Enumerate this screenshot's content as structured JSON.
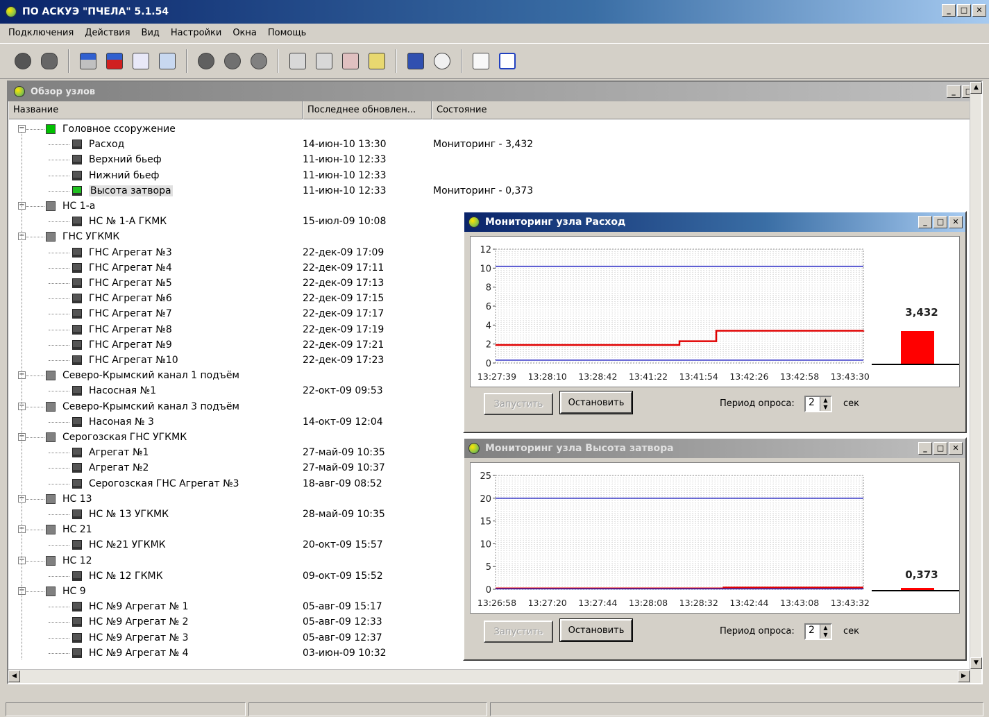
{
  "app": {
    "title": "ПО АСКУЭ \"ПЧЕЛА\" 5.1.54"
  },
  "menu": [
    "Подключения",
    "Действия",
    "Вид",
    "Настройки",
    "Окна",
    "Помощь"
  ],
  "toolbar": {
    "icons": [
      "connect-icon",
      "disconnect-icon",
      "start-poll-icon",
      "stop-poll-icon",
      "edit-icon",
      "report-icon",
      "node-add-icon",
      "node-remove-icon",
      "node-settings-icon",
      "export-icon",
      "import-icon",
      "delete-icon",
      "config-icon",
      "table-icon",
      "clock-icon",
      "document-icon",
      "refresh-icon"
    ]
  },
  "overview": {
    "title": "Обзор узлов",
    "columns": [
      "Название",
      "Последнее обновлен...",
      "Состояние"
    ],
    "rows": [
      {
        "level": 1,
        "kind": "group",
        "name": "Головное ссоружение",
        "date": "",
        "state": "",
        "color": "#00c000"
      },
      {
        "level": 2,
        "kind": "leaf",
        "name": "Расход",
        "date": "14-июн-10 13:30",
        "state": "Мониторинг - 3,432"
      },
      {
        "level": 2,
        "kind": "leaf",
        "name": "Верхний бьеф",
        "date": "11-июн-10 12:33",
        "state": ""
      },
      {
        "level": 2,
        "kind": "leaf",
        "name": "Нижний бьеф",
        "date": "11-июн-10 12:33",
        "state": ""
      },
      {
        "level": 2,
        "kind": "leaf-green",
        "name": "Высота затвора",
        "date": "11-июн-10 12:33",
        "state": "Мониторинг - 0,373",
        "selected": true
      },
      {
        "level": 1,
        "kind": "group",
        "name": "НС 1-а",
        "date": "",
        "state": "",
        "color": "#808080"
      },
      {
        "level": 2,
        "kind": "leaf",
        "name": "НС № 1-А ГКМК",
        "date": "15-июл-09 10:08",
        "state": ""
      },
      {
        "level": 1,
        "kind": "group",
        "name": "ГНС УГКМК",
        "date": "",
        "state": "",
        "color": "#808080"
      },
      {
        "level": 2,
        "kind": "leaf",
        "name": "ГНС Агрегат №3",
        "date": "22-дек-09 17:09",
        "state": ""
      },
      {
        "level": 2,
        "kind": "leaf",
        "name": "ГНС Агрегат №4",
        "date": "22-дек-09 17:11",
        "state": ""
      },
      {
        "level": 2,
        "kind": "leaf",
        "name": "ГНС Агрегат №5",
        "date": "22-дек-09 17:13",
        "state": ""
      },
      {
        "level": 2,
        "kind": "leaf",
        "name": "ГНС Агрегат №6",
        "date": "22-дек-09 17:15",
        "state": ""
      },
      {
        "level": 2,
        "kind": "leaf",
        "name": "ГНС Агрегат №7",
        "date": "22-дек-09 17:17",
        "state": ""
      },
      {
        "level": 2,
        "kind": "leaf",
        "name": "ГНС Агрегат №8",
        "date": "22-дек-09 17:19",
        "state": ""
      },
      {
        "level": 2,
        "kind": "leaf",
        "name": "ГНС Агрегат №9",
        "date": "22-дек-09 17:21",
        "state": ""
      },
      {
        "level": 2,
        "kind": "leaf",
        "name": "ГНС Агрегат №10",
        "date": "22-дек-09 17:23",
        "state": ""
      },
      {
        "level": 1,
        "kind": "group",
        "name": "Северо-Крымский канал 1 подъём",
        "date": "",
        "state": "",
        "color": "#808080"
      },
      {
        "level": 2,
        "kind": "leaf",
        "name": "Насосная №1",
        "date": "22-окт-09 09:53",
        "state": ""
      },
      {
        "level": 1,
        "kind": "group",
        "name": "Северо-Крымский канал 3 подъём",
        "date": "",
        "state": "",
        "color": "#808080"
      },
      {
        "level": 2,
        "kind": "leaf",
        "name": "Насоная № 3",
        "date": "14-окт-09 12:04",
        "state": ""
      },
      {
        "level": 1,
        "kind": "group",
        "name": "Серогозская ГНС УГКМК",
        "date": "",
        "state": "",
        "color": "#808080"
      },
      {
        "level": 2,
        "kind": "leaf",
        "name": "Агрегат №1",
        "date": "27-май-09 10:35",
        "state": ""
      },
      {
        "level": 2,
        "kind": "leaf",
        "name": "Агрегат №2",
        "date": "27-май-09 10:37",
        "state": ""
      },
      {
        "level": 2,
        "kind": "leaf",
        "name": "Серогозская ГНС Агрегат №3",
        "date": "18-авг-09 08:52",
        "state": ""
      },
      {
        "level": 1,
        "kind": "group",
        "name": "НС 13",
        "date": "",
        "state": "",
        "color": "#808080"
      },
      {
        "level": 2,
        "kind": "leaf",
        "name": "НС № 13 УГКМК",
        "date": "28-май-09 10:35",
        "state": ""
      },
      {
        "level": 1,
        "kind": "group",
        "name": "НС 21",
        "date": "",
        "state": "",
        "color": "#808080"
      },
      {
        "level": 2,
        "kind": "leaf",
        "name": "НС №21 УГКМК",
        "date": "20-окт-09 15:57",
        "state": ""
      },
      {
        "level": 1,
        "kind": "group",
        "name": "НС 12",
        "date": "",
        "state": "",
        "color": "#808080"
      },
      {
        "level": 2,
        "kind": "leaf",
        "name": "НС № 12 ГКМК",
        "date": "09-окт-09 15:52",
        "state": ""
      },
      {
        "level": 1,
        "kind": "group",
        "name": "НС 9",
        "date": "",
        "state": "",
        "color": "#808080"
      },
      {
        "level": 2,
        "kind": "leaf",
        "name": "НС №9 Агрегат № 1",
        "date": "05-авг-09 15:17",
        "state": ""
      },
      {
        "level": 2,
        "kind": "leaf",
        "name": "НС №9 Агрегат № 2",
        "date": "05-авг-09 12:33",
        "state": ""
      },
      {
        "level": 2,
        "kind": "leaf",
        "name": "НС №9 Агрегат № 3",
        "date": "05-авг-09 12:37",
        "state": ""
      },
      {
        "level": 2,
        "kind": "leaf",
        "name": "НС №9 Агрегат № 4",
        "date": "03-июн-09 10:32",
        "state": ""
      }
    ]
  },
  "monitor1": {
    "title": "Мониторинг узла Расход",
    "value_label": "3,432",
    "level_fraction": 0.286,
    "start_button": "Запустить",
    "stop_button": "Остановить",
    "period_label": "Период опроса:",
    "period_value": "2",
    "unit": "сек"
  },
  "monitor2": {
    "title": "Мониторинг узла Высота затвора",
    "value_label": "0,373",
    "level_fraction": 0.015,
    "start_button": "Запустить",
    "stop_button": "Остановить",
    "period_label": "Период опроса:",
    "period_value": "2",
    "unit": "сек"
  },
  "chart_data": [
    {
      "type": "line",
      "x": [
        "13:27:39",
        "13:28:10",
        "13:28:42",
        "13:41:22",
        "13:41:54",
        "13:42:26",
        "13:42:58",
        "13:43:30"
      ],
      "yticks": [
        0,
        2,
        4,
        6,
        8,
        10,
        12
      ],
      "ylim": [
        0,
        12
      ],
      "series": [
        {
          "color": "#e00000",
          "points": [
            [
              0,
              1.9
            ],
            [
              0.46,
              1.9
            ],
            [
              0.5,
              2.3
            ],
            [
              0.58,
              2.3
            ],
            [
              0.6,
              3.4
            ],
            [
              1,
              3.432
            ]
          ]
        },
        {
          "color": "#2020c0",
          "points": [
            [
              0,
              10.2
            ],
            [
              1,
              10.2
            ]
          ]
        },
        {
          "color": "#2020c0",
          "points": [
            [
              0,
              0.3
            ],
            [
              1,
              0.3
            ]
          ]
        }
      ],
      "grid": true
    },
    {
      "type": "line",
      "x": [
        "13:26:58",
        "13:27:20",
        "13:27:44",
        "13:28:08",
        "13:28:32",
        "13:42:44",
        "13:43:08",
        "13:43:32"
      ],
      "yticks": [
        0,
        5,
        10,
        15,
        20,
        25
      ],
      "ylim": [
        0,
        25
      ],
      "series": [
        {
          "color": "#e00000",
          "points": [
            [
              0,
              0.2
            ],
            [
              0.6,
              0.2
            ],
            [
              0.62,
              0.373
            ],
            [
              1,
              0.373
            ]
          ]
        },
        {
          "color": "#2020c0",
          "points": [
            [
              0,
              20
            ],
            [
              1,
              20
            ]
          ]
        },
        {
          "color": "#2020c0",
          "points": [
            [
              0,
              0.1
            ],
            [
              1,
              0.1
            ]
          ]
        }
      ],
      "grid": true
    }
  ]
}
